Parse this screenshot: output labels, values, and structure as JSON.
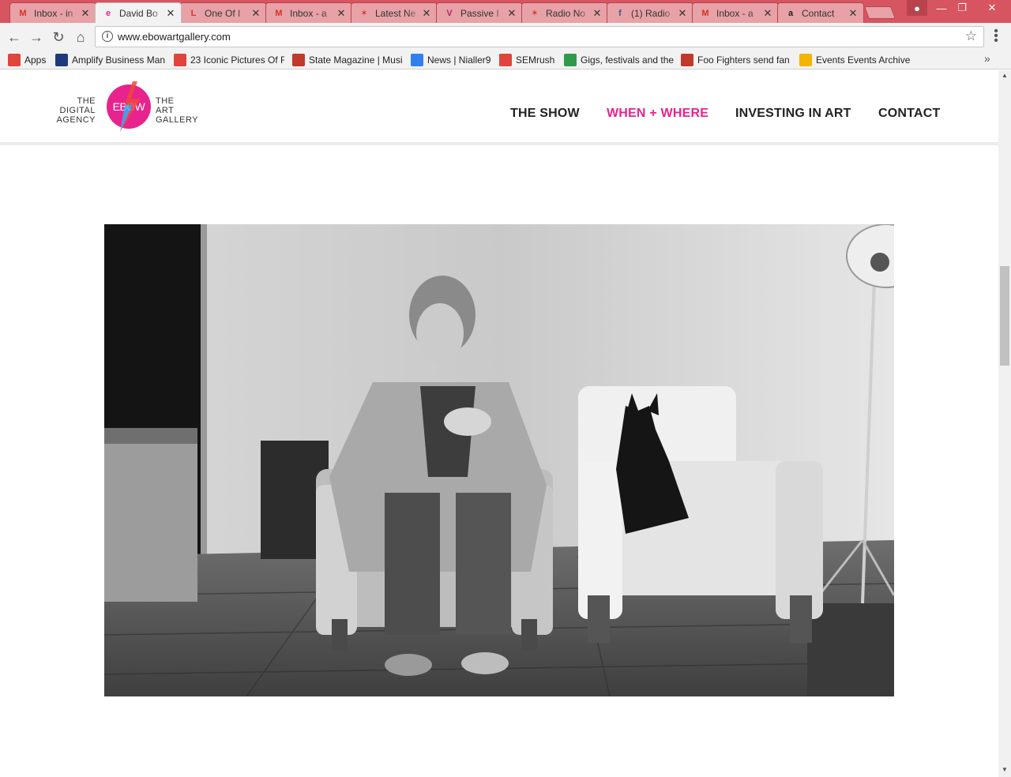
{
  "browser": {
    "tabs": [
      {
        "title": "Inbox - in",
        "icon": "gmail-icon",
        "icon_color": "#d93025",
        "glyph": "M",
        "active": false
      },
      {
        "title": "David Bo",
        "icon": "ebow-icon",
        "icon_color": "#e8238d",
        "glyph": "e",
        "active": true
      },
      {
        "title": "One Of I",
        "icon": "letter-l-icon",
        "icon_color": "#d9342b",
        "glyph": "L",
        "active": false
      },
      {
        "title": "Inbox - a",
        "icon": "gmail-icon",
        "icon_color": "#d93025",
        "glyph": "M",
        "active": false
      },
      {
        "title": "Latest Ne",
        "icon": "star-icon",
        "icon_color": "#d9342b",
        "glyph": "✶",
        "active": false
      },
      {
        "title": "Passive I",
        "icon": "v-icon",
        "icon_color": "#b4246e",
        "glyph": "V",
        "active": false
      },
      {
        "title": "Radio No",
        "icon": "star-icon",
        "icon_color": "#d9342b",
        "glyph": "✶",
        "active": false
      },
      {
        "title": "(1) Radio",
        "icon": "facebook-icon",
        "icon_color": "#3b5998",
        "glyph": "f",
        "active": false
      },
      {
        "title": "Inbox - a",
        "icon": "gmail-icon",
        "icon_color": "#d93025",
        "glyph": "M",
        "active": false
      },
      {
        "title": "Contact",
        "icon": "amazon-icon",
        "icon_color": "#222222",
        "glyph": "a",
        "active": false
      }
    ],
    "url": "www.ebowartgallery.com",
    "bookmarks": [
      {
        "title": "Apps",
        "icon": "apps-grid-icon",
        "icon_color": "#e0443c"
      },
      {
        "title": "Amplify Business Man",
        "icon": "amplify-icon",
        "icon_color": "#1f3a7a"
      },
      {
        "title": "23 Iconic Pictures Of F",
        "icon": "trend-icon",
        "icon_color": "#e0443c"
      },
      {
        "title": "State Magazine | Musi",
        "icon": "state-icon",
        "icon_color": "#c0392b"
      },
      {
        "title": "News | Nialler9",
        "icon": "circle-icon",
        "icon_color": "#2f80ed"
      },
      {
        "title": "SEMrush",
        "icon": "semrush-icon",
        "icon_color": "#e0443c"
      },
      {
        "title": "Gigs, festivals and the",
        "icon": "harp-icon",
        "icon_color": "#2e9b4a"
      },
      {
        "title": "Foo Fighters send fan",
        "icon": "ri-icon",
        "icon_color": "#c0392b"
      },
      {
        "title": "Events Events Archive",
        "icon": "events-icon",
        "icon_color": "#f4b400"
      }
    ]
  },
  "site": {
    "logo": {
      "left_line1": "THE",
      "left_line2": "DIGITAL",
      "left_line3": "AGENCY",
      "center": "EBOW",
      "right_line1": "THE",
      "right_line2": "ART",
      "right_line3": "GALLERY",
      "brand_color": "#e8238d"
    },
    "nav": [
      {
        "label": "THE SHOW",
        "active": false
      },
      {
        "label": "WHEN + WHERE",
        "active": true
      },
      {
        "label": "INVESTING IN ART",
        "active": false
      },
      {
        "label": "CONTACT",
        "active": false
      }
    ]
  }
}
